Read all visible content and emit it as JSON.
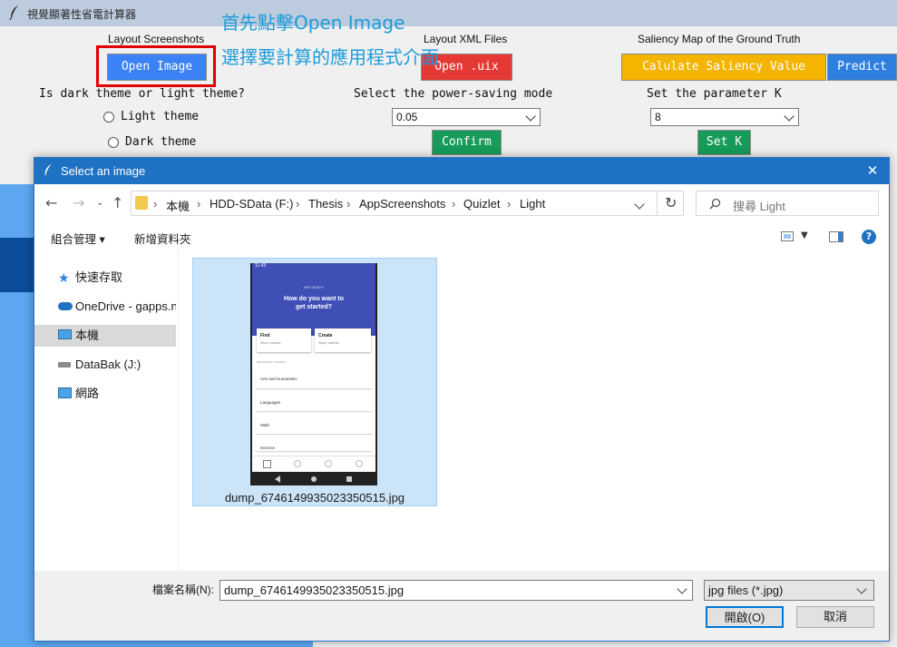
{
  "app": {
    "title": "視覺顯著性省電計算器",
    "columns": {
      "screenshots_label": "Layout Screenshots",
      "xml_label": "Layout XML Files",
      "saliency_label": "Saliency Map of the Ground Truth"
    },
    "buttons": {
      "open_image": "Open Image",
      "open_uix": "Open .uix",
      "calculate_saliency": "Calulate Saliency Value",
      "predict": "Predict",
      "confirm": "Confirm",
      "set_k": "Set K"
    },
    "theme_question": "Is dark theme or light theme?",
    "theme_options": [
      "Light theme",
      "Dark theme"
    ],
    "power_mode_label": "Select the power-saving mode",
    "power_mode_value": "0.05",
    "param_k_label": "Set the parameter K",
    "param_k_value": "8",
    "colors": {
      "open_image_bg": "#3b82f6",
      "open_uix_bg": "#e53935",
      "saliency_bg": "#f4b400",
      "predict_bg": "#2f7fe0",
      "confirm_bg": "#169b5a",
      "annotation_box": "#e00000",
      "annotation_text": "#1e9bd7"
    }
  },
  "annotations": {
    "step1": "首先點擊Open Image",
    "step2": "選擇要計算的應用程式介面"
  },
  "dialog": {
    "title": "Select an image",
    "close_glyph": "✕",
    "breadcrumb": [
      "本機",
      "HDD-SData (F:)",
      "Thesis",
      "AppScreenshots",
      "Quizlet",
      "Light"
    ],
    "search_placeholder": "搜尋 Light",
    "organize_label": "組合管理 ▾",
    "new_folder_label": "新增資料夾",
    "nav_items": [
      {
        "label": "快速存取",
        "icon": "star-icon"
      },
      {
        "label": "OneDrive - gapps.n",
        "icon": "cloud-icon"
      },
      {
        "label": "本機",
        "icon": "computer-icon"
      },
      {
        "label": "DataBak (J:)",
        "icon": "drive-icon"
      },
      {
        "label": "網路",
        "icon": "network-icon"
      }
    ],
    "file": {
      "name": "dump_6746149935023350515.jpg",
      "thumb": {
        "status": "11:43",
        "greeting": "HEY RUDY!",
        "headline_1": "How do you want to",
        "headline_2": "get started?",
        "card1_title": "Find",
        "card1_sub": "Study material",
        "card2_title": "Create",
        "card2_sub": "Study material",
        "section": "BROWSE BY SUBJECT",
        "rows": [
          "Arts and Humanities",
          "Languages",
          "Math",
          "Science"
        ]
      }
    },
    "filename_label": "檔案名稱(N):",
    "filename_value": "dump_6746149935023350515.jpg",
    "filetype_value": "jpg files (*.jpg)",
    "open_button": "開啟(O)",
    "cancel_button": "取消"
  }
}
